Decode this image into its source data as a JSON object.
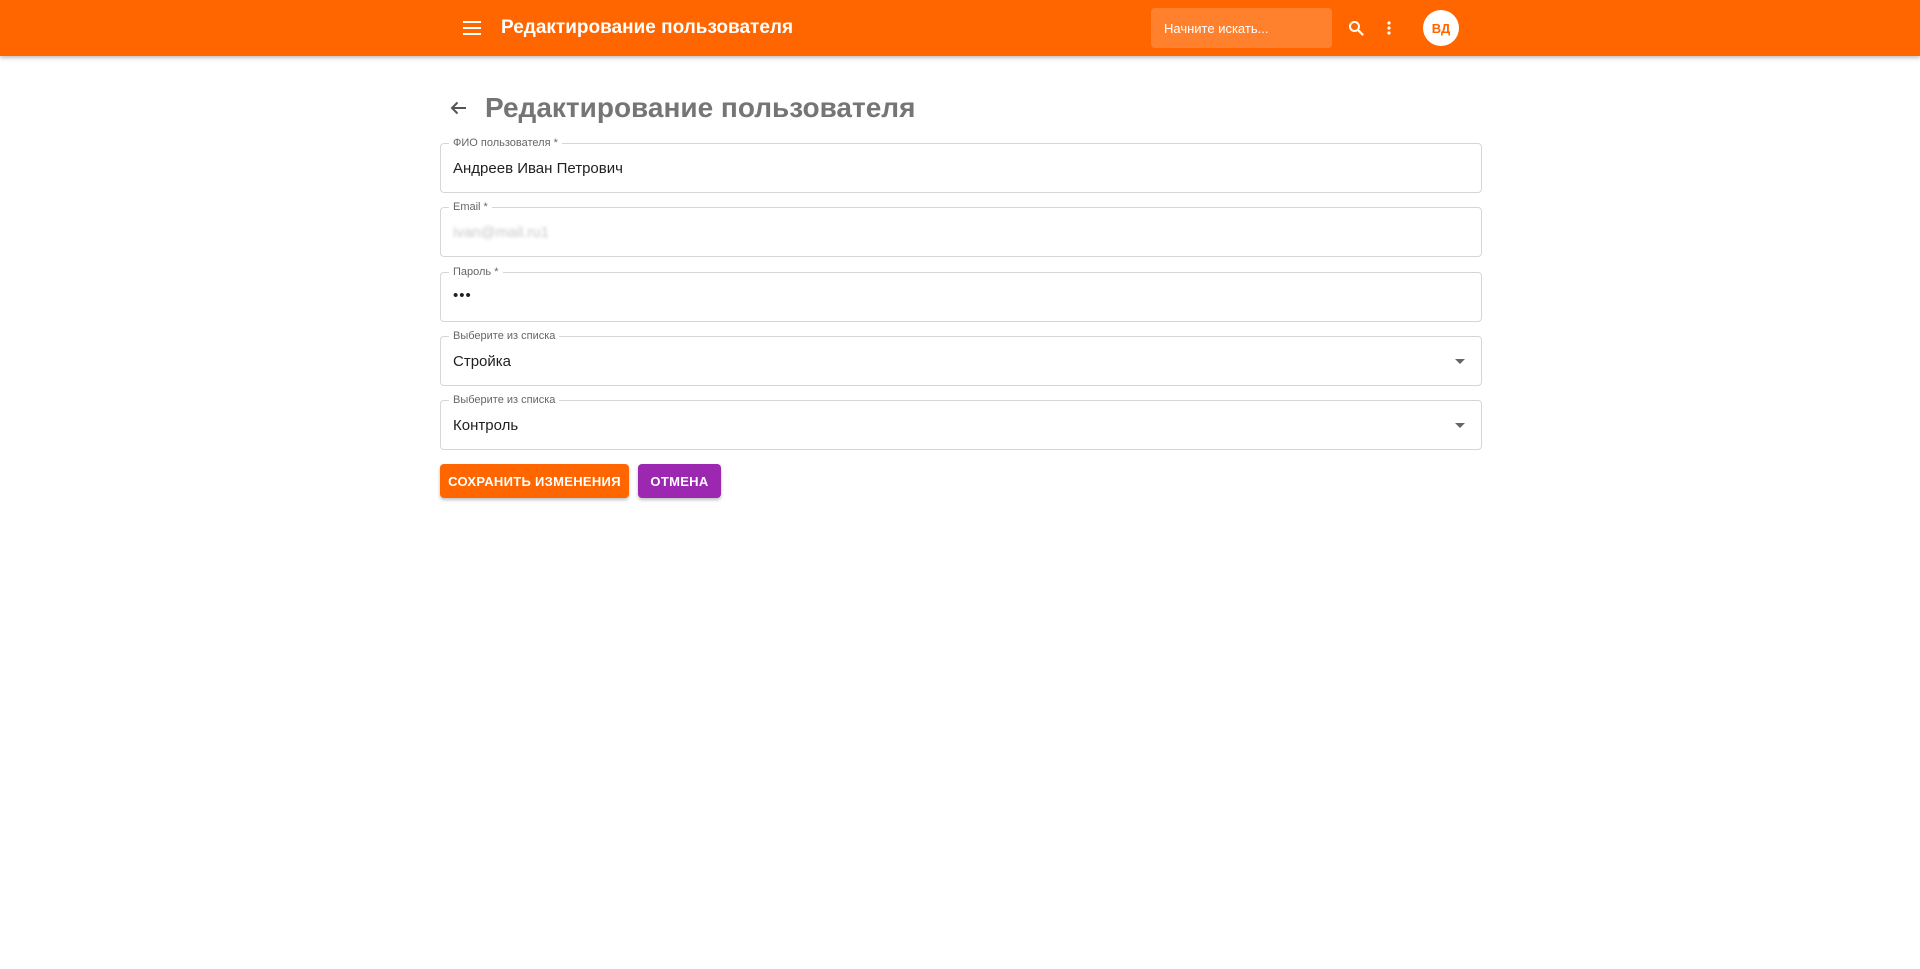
{
  "colors": {
    "primary": "#ff6600",
    "secondary": "#9c27b0",
    "title_gray": "#757575"
  },
  "header": {
    "menu_icon": "menu-icon",
    "title": "Редактирование пользователя",
    "search_placeholder": "Начните искать...",
    "search_icon": "search-icon",
    "more_icon": "more-vert-icon",
    "avatar_initials": "ВД"
  },
  "page": {
    "back_icon": "arrow-back-icon",
    "title": "Редактирование пользователя"
  },
  "form": {
    "full_name": {
      "label": "ФИО пользователя *",
      "value": "Андреев Иван Петрович"
    },
    "email": {
      "label": "Email *",
      "value": "ivan@mail.ru1"
    },
    "password": {
      "label": "Пароль *",
      "value": "•••"
    },
    "select_1": {
      "label": "Выберите из списка",
      "value": "Стройка"
    },
    "select_2": {
      "label": "Выберите из списка",
      "value": "Контроль"
    }
  },
  "actions": {
    "save_label": "СОХРАНИТЬ ИЗМЕНЕНИЯ",
    "cancel_label": "ОТМЕНА"
  }
}
